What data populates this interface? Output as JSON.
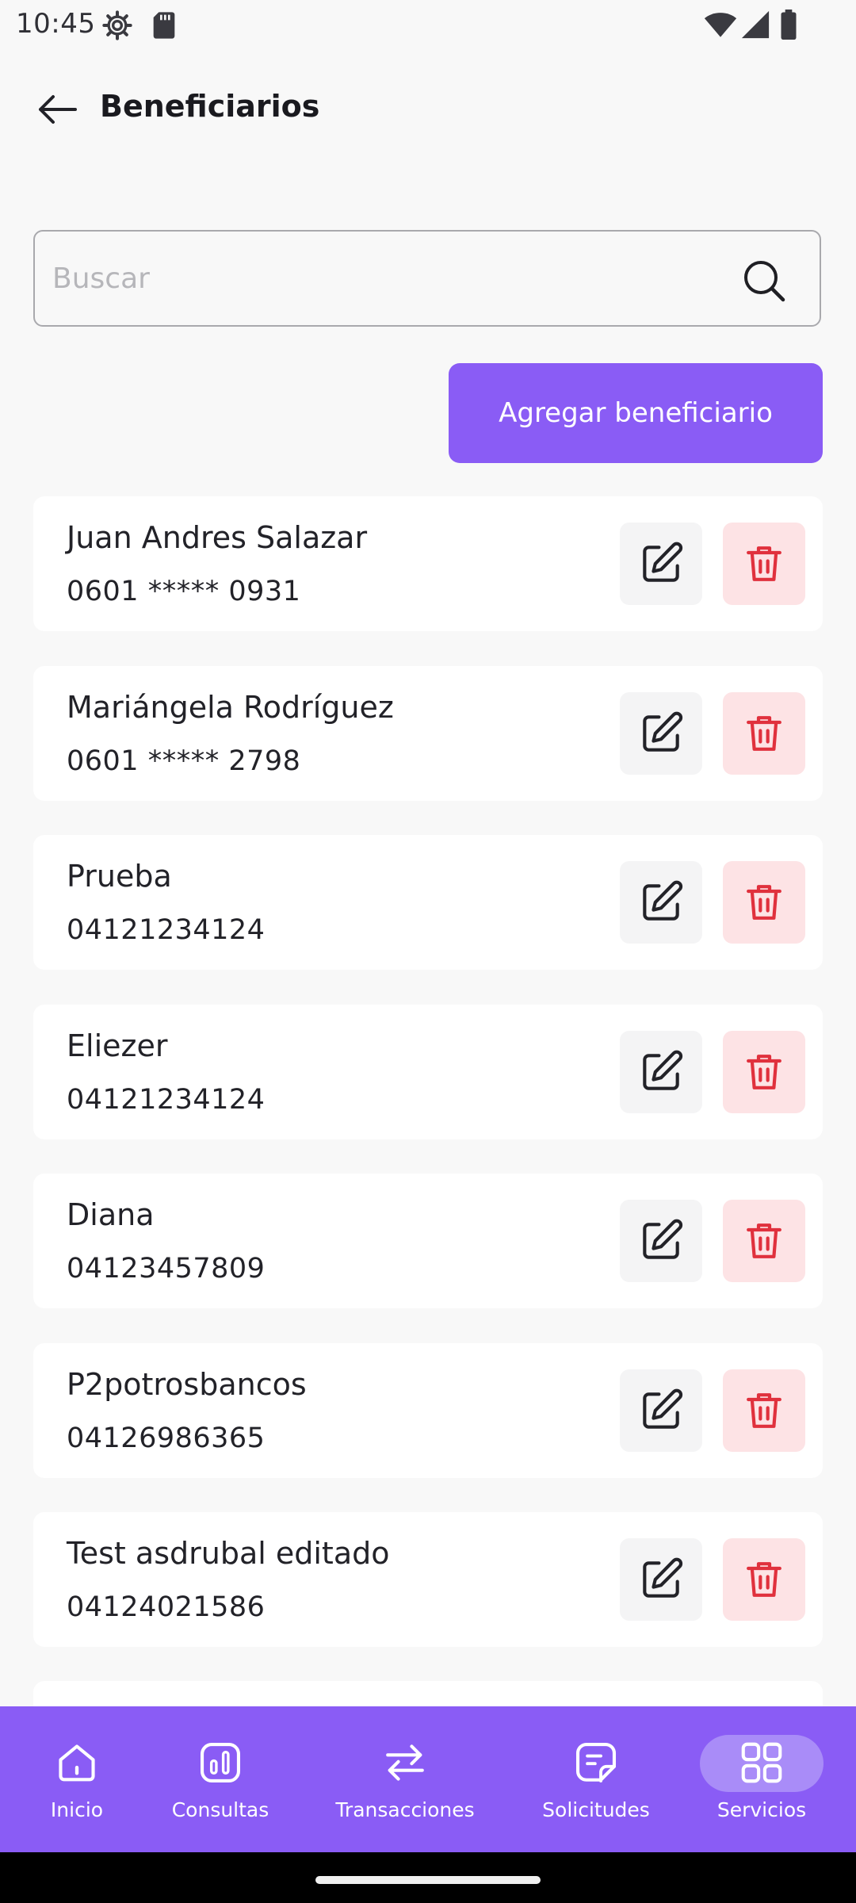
{
  "status_bar": {
    "time": "10:45"
  },
  "header": {
    "title": "Beneficiarios"
  },
  "search": {
    "placeholder": "Buscar",
    "value": ""
  },
  "add_button_label": "Agregar beneficiario",
  "beneficiaries": [
    {
      "name": "Juan Andres Salazar",
      "id": "0601 ***** 0931"
    },
    {
      "name": "Mariángela Rodríguez",
      "id": "0601 ***** 2798"
    },
    {
      "name": "Prueba",
      "id": "04121234124"
    },
    {
      "name": "Eliezer",
      "id": "04121234124"
    },
    {
      "name": "Diana",
      "id": "04123457809"
    },
    {
      "name": "P2potrosbancos",
      "id": "04126986365"
    },
    {
      "name": "Test asdrubal editado",
      "id": "04124021586"
    }
  ],
  "bottom_nav": {
    "items": [
      {
        "label": "Inicio",
        "icon": "home-icon"
      },
      {
        "label": "Consultas",
        "icon": "chart-icon"
      },
      {
        "label": "Transacciones",
        "icon": "transfer-icon"
      },
      {
        "label": "Solicitudes",
        "icon": "document-icon"
      },
      {
        "label": "Servicios",
        "icon": "grid-icon",
        "active": true
      }
    ]
  },
  "colors": {
    "accent": "#8a5cf5",
    "delete_bg": "#fde3e5",
    "delete_icon": "#e0313d",
    "edit_bg": "#f4f4f5"
  }
}
